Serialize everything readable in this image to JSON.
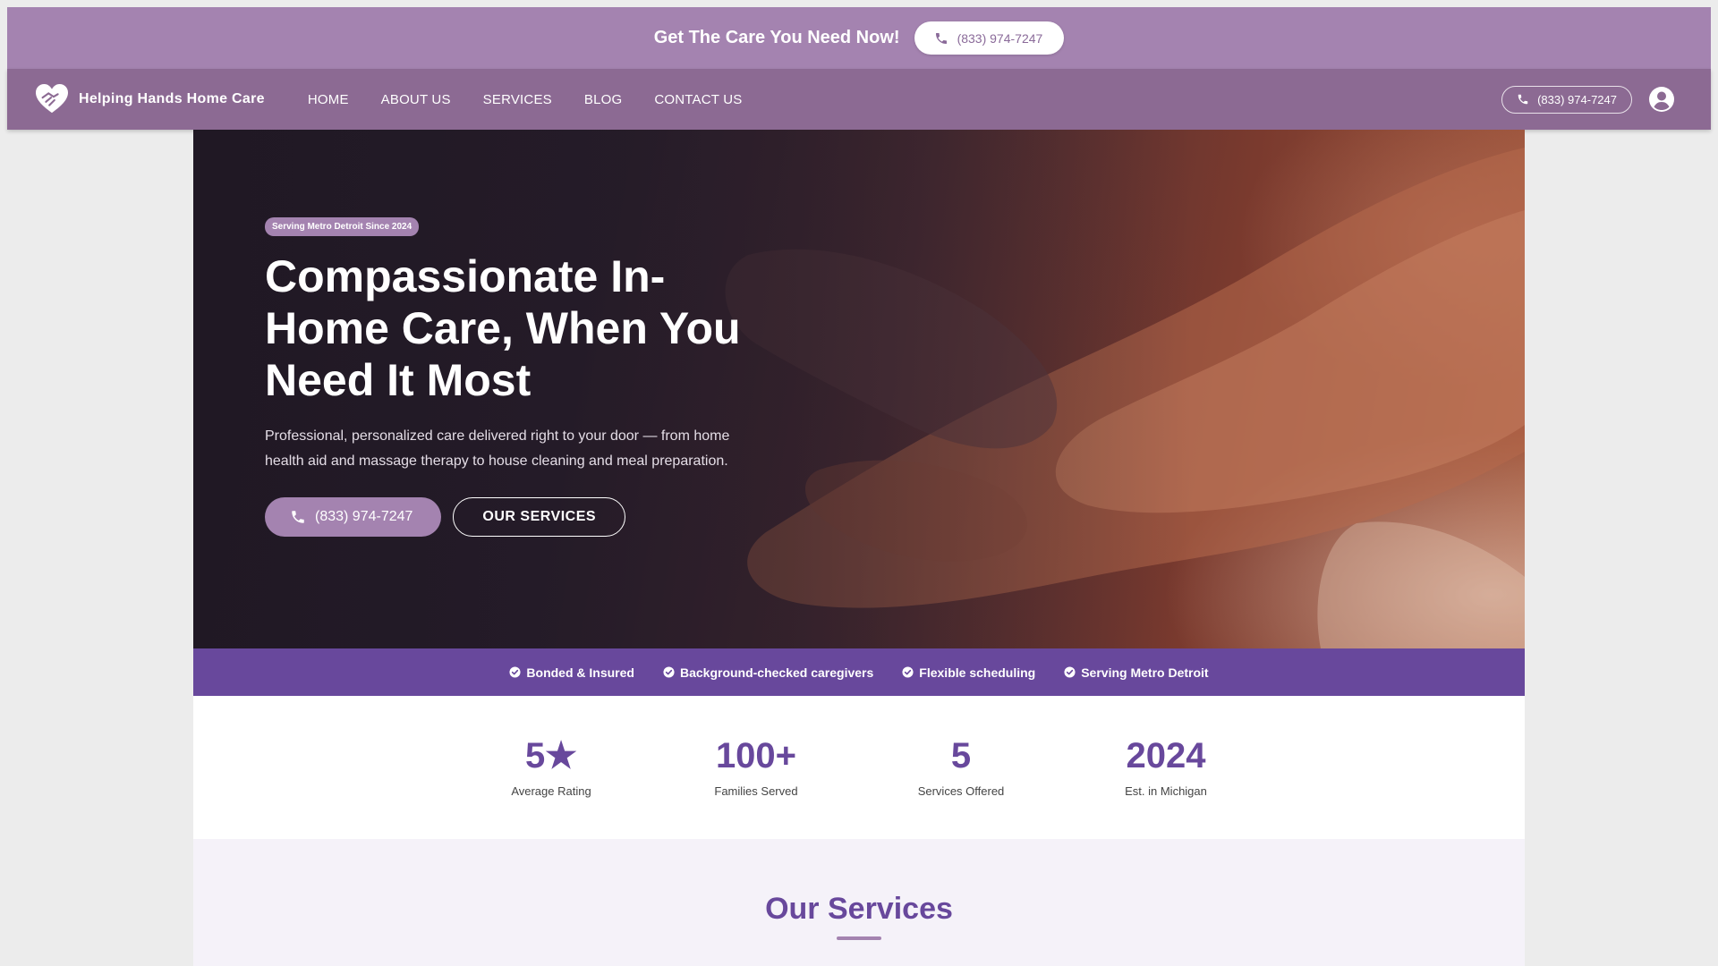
{
  "promo": {
    "text": "Get The Care You Need Now!",
    "phone": "(833) 974-7247"
  },
  "nav": {
    "brand_name": "Helping Hands Home Care",
    "links": [
      "HOME",
      "ABOUT US",
      "SERVICES",
      "BLOG",
      "CONTACT US"
    ],
    "phone": "(833) 974-7247",
    "icons": {
      "logo": "heart-hands-icon",
      "phone": "phone-icon",
      "account": "account-circle-icon"
    }
  },
  "hero": {
    "badge": "Serving Metro Detroit Since 2024",
    "title": "Compassionate In-Home Care, When You Need It Most",
    "description": "Professional, personalized care delivered right to your door — from home health aid and massage therapy to house cleaning and meal preparation.",
    "call_button": "(833) 974-7247",
    "services_button": "OUR SERVICES"
  },
  "trust": {
    "items": [
      "Bonded & Insured",
      "Background-checked caregivers",
      "Flexible scheduling",
      "Serving Metro Detroit"
    ],
    "icon": "check-circle-icon"
  },
  "stats": [
    {
      "value": "5★",
      "label": "Average Rating"
    },
    {
      "value": "100+",
      "label": "Families Served"
    },
    {
      "value": "5",
      "label": "Services Offered"
    },
    {
      "value": "2024",
      "label": "Est. in Michigan"
    }
  ],
  "services": {
    "title": "Our Services"
  },
  "colors": {
    "lavender": "#a483b0",
    "nav_purple": "#8c6a93",
    "deep_purple": "#68489c",
    "services_bg": "#f5f2f9"
  }
}
